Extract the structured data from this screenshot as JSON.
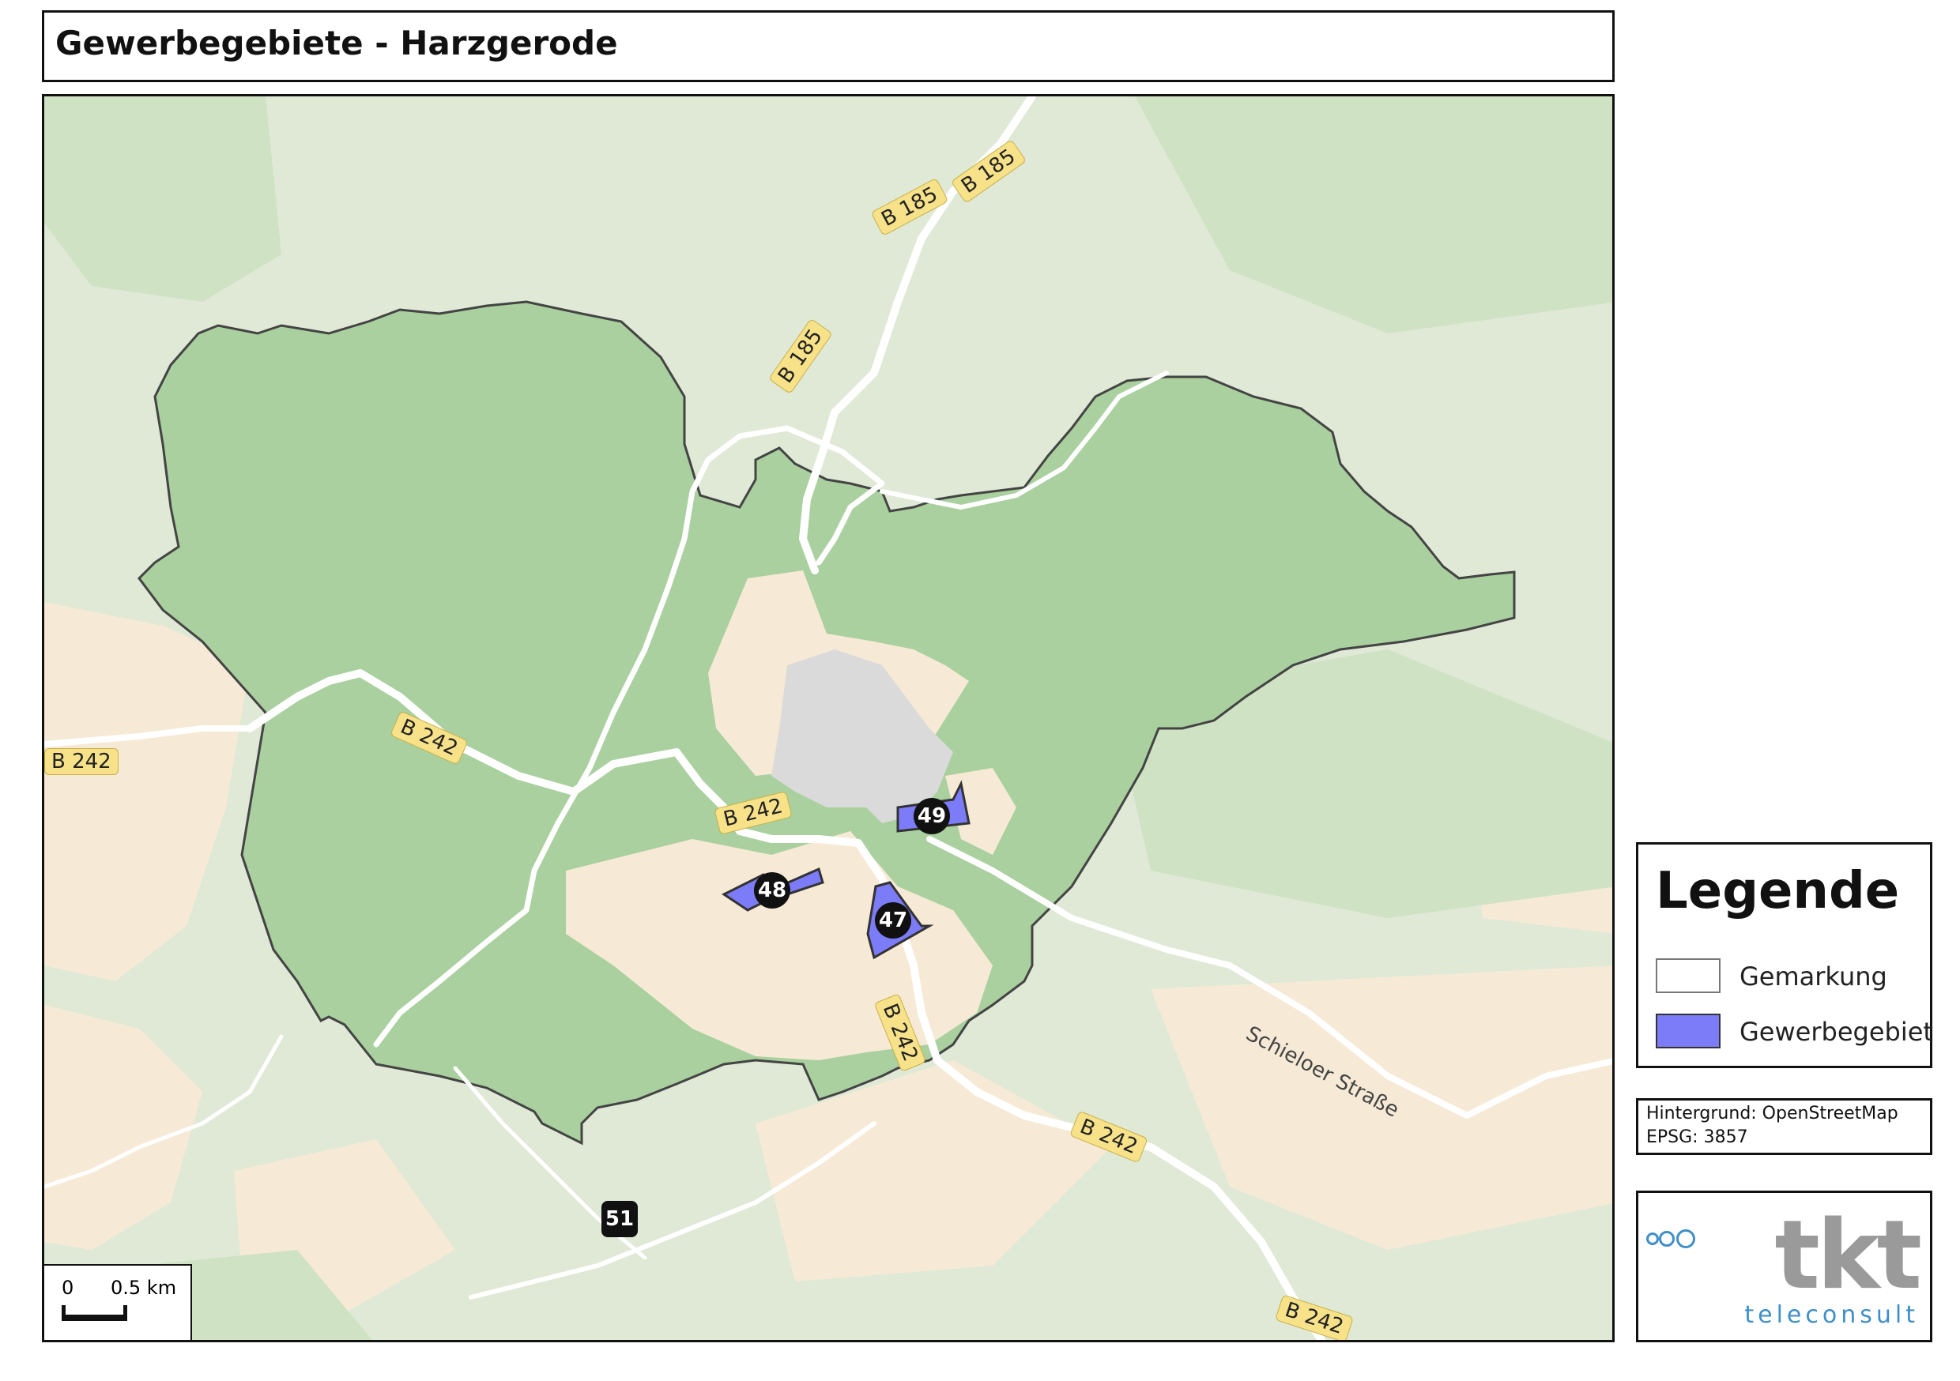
{
  "title": "Gewerbegebiete - Harzgerode",
  "map": {
    "road_labels": [
      {
        "text": "B 185",
        "rot": -28
      },
      {
        "text": "B 185",
        "rot": -35
      },
      {
        "text": "B 185",
        "rot": -55
      },
      {
        "text": "B 242",
        "rot": 24
      },
      {
        "text": "B 242",
        "rot": 0
      },
      {
        "text": "B 242",
        "rot": -14
      },
      {
        "text": "B 242",
        "rot": 68
      },
      {
        "text": "B 242",
        "rot": 22
      },
      {
        "text": "B 242",
        "rot": 18
      }
    ],
    "street_label": "Schieloer Straße",
    "areas": [
      {
        "id": "47"
      },
      {
        "id": "48"
      },
      {
        "id": "49"
      },
      {
        "id": "51"
      }
    ],
    "colors": {
      "forest": "#a9d09e",
      "background": "#dfe9d6",
      "farmland": "#f6ead6",
      "road": "#ffffff",
      "gewerbe": "#7c7cf8"
    }
  },
  "scale": {
    "zero": "0",
    "distance": "0.5 km"
  },
  "legend": {
    "title": "Legende",
    "items": [
      {
        "label": "Gemarkung",
        "swatch": "#ffffff"
      },
      {
        "label": "Gewerbegebiet",
        "swatch": "#7c7cf8"
      }
    ]
  },
  "source": {
    "line1": "Hintergrund: OpenStreetMap",
    "line2": "EPSG: 3857"
  },
  "logo": {
    "word": "tkt",
    "sub": "teleconsult"
  }
}
